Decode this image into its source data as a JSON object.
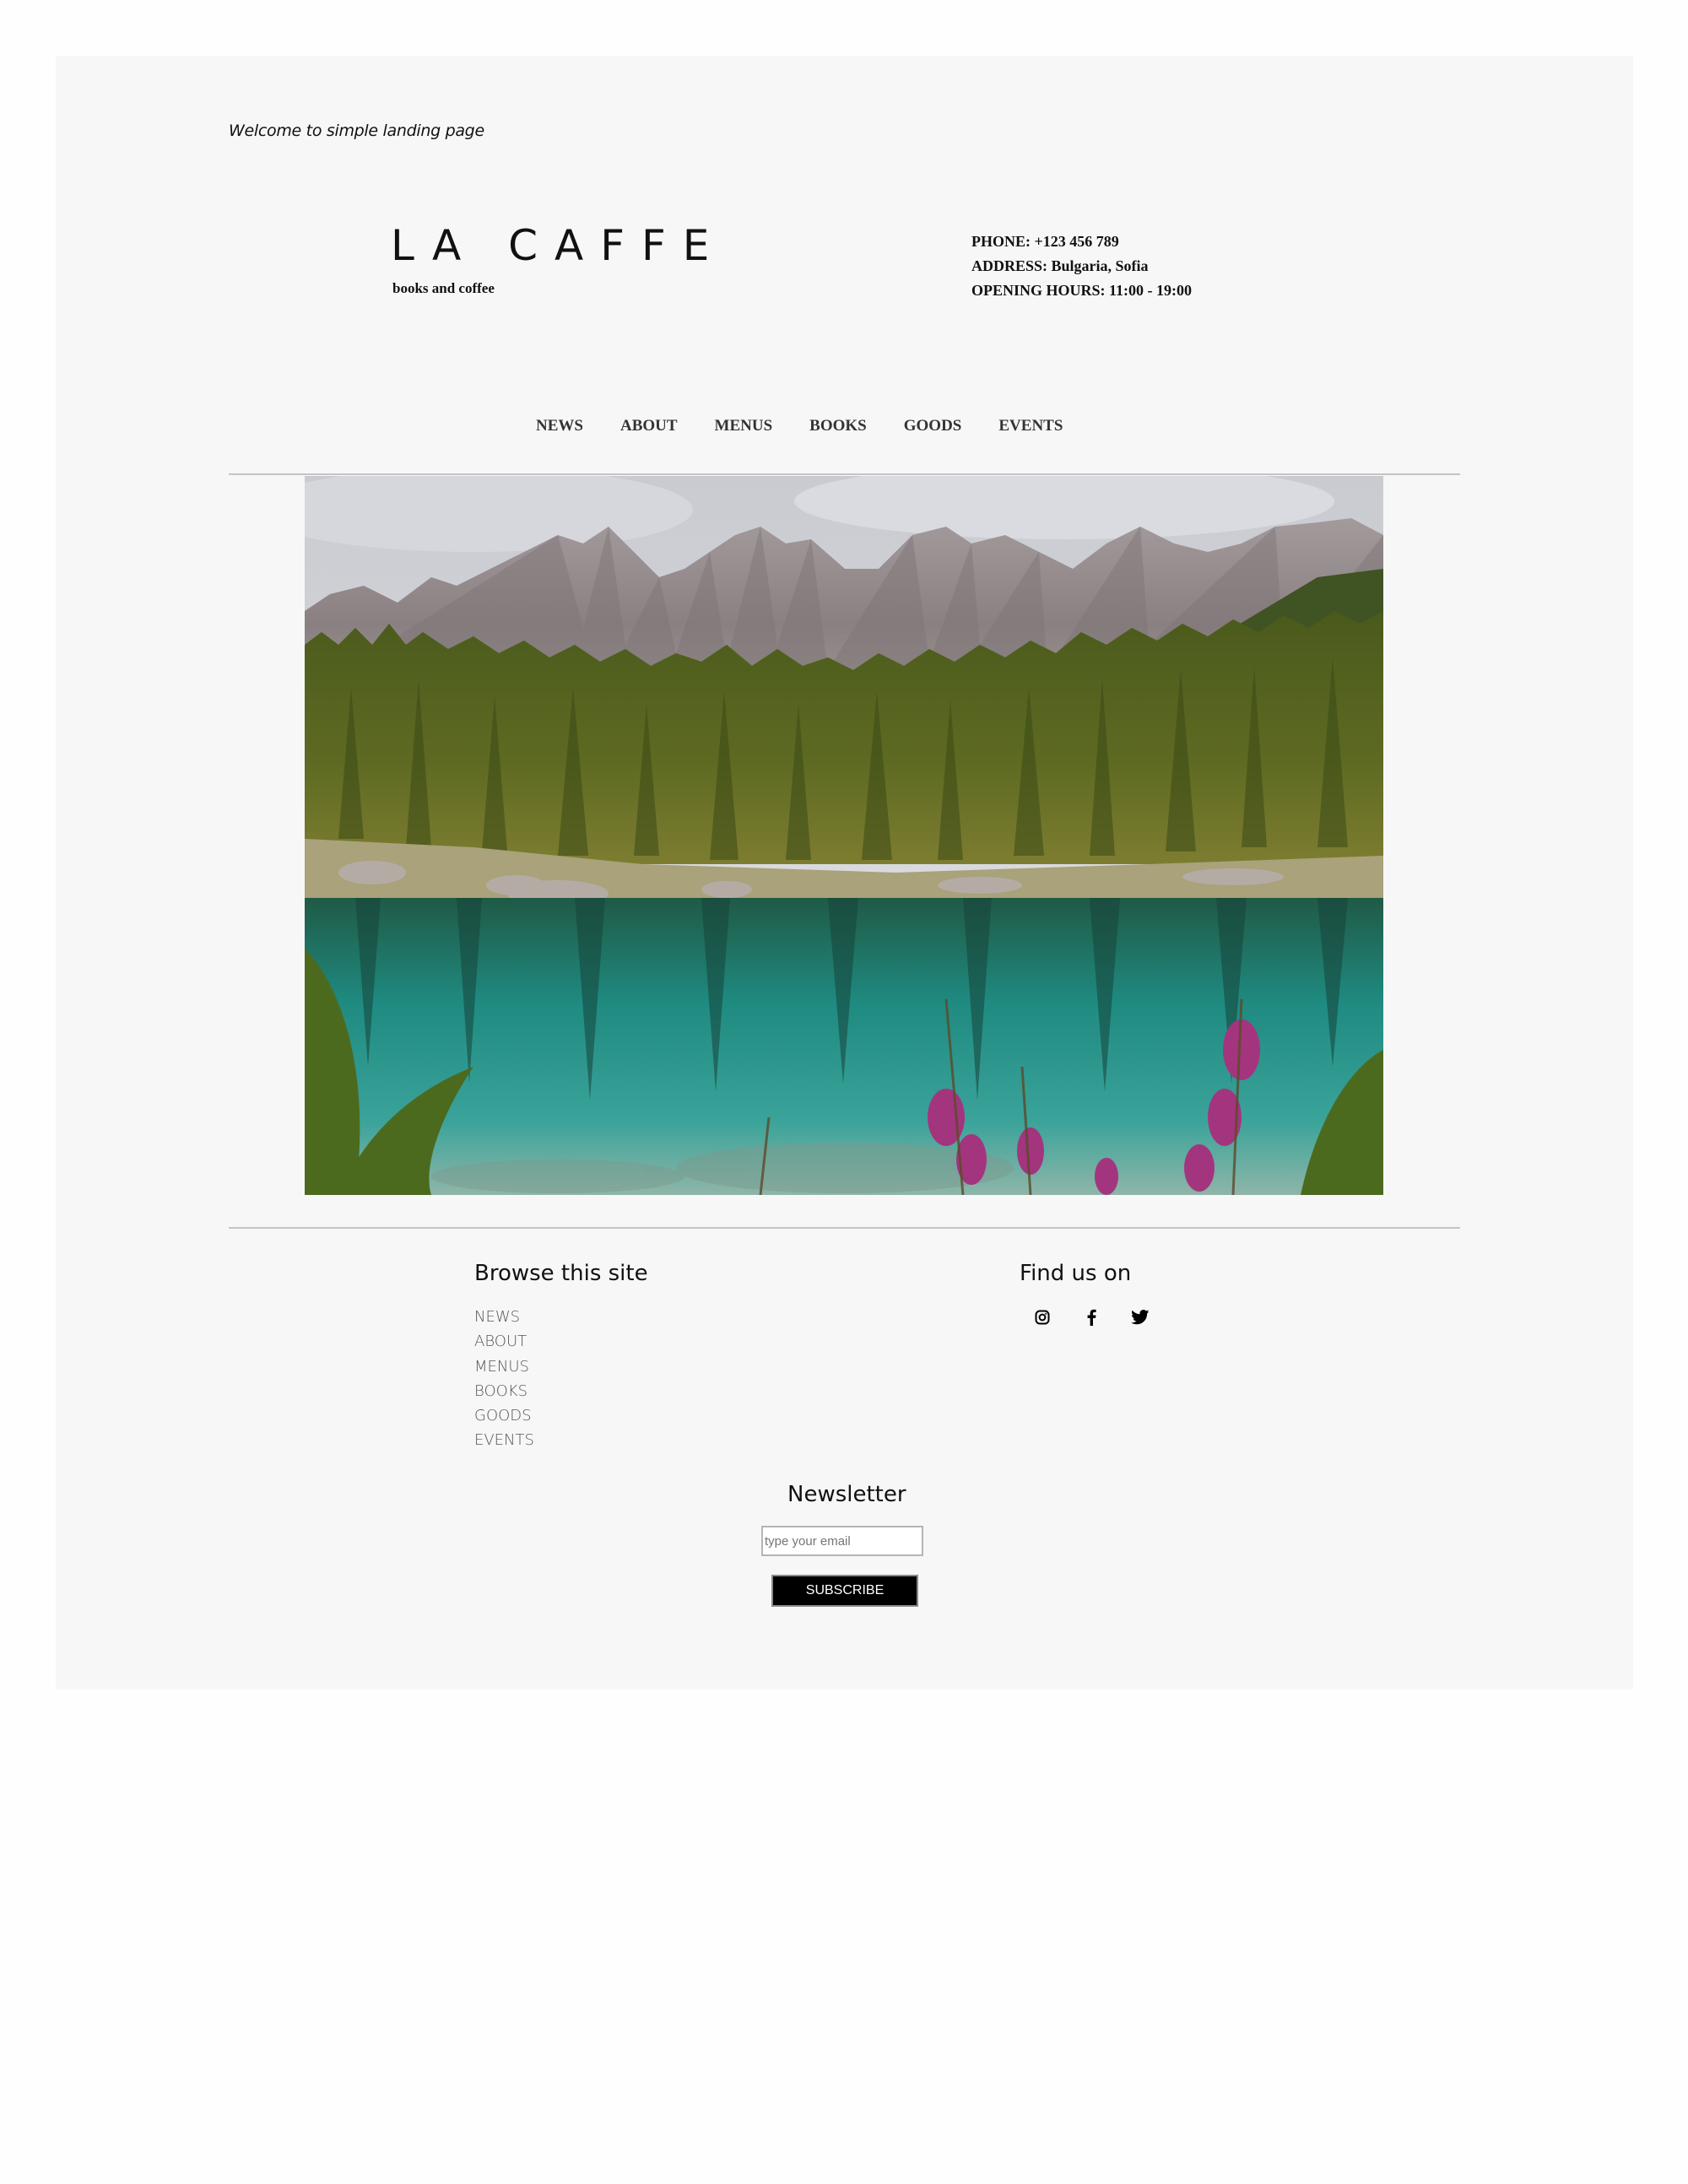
{
  "header": {
    "welcome": "Welcome to simple landing page",
    "logo_title": "LA CAFFE",
    "logo_subtitle": "books and coffee",
    "contact": {
      "phone": "PHONE: +123 456 789",
      "address": "ADDRESS: Bulgaria, Sofia",
      "hours": "OPENING HOURS: 11:00 - 19:00"
    }
  },
  "nav": {
    "items": [
      "NEWS",
      "ABOUT",
      "MENUS",
      "BOOKS",
      "GOODS",
      "EVENTS"
    ]
  },
  "hero": {
    "image": "mountain-lake-landscape"
  },
  "footer": {
    "browse_title": "Browse this site",
    "browse_items": [
      "NEWS",
      "ABOUT",
      "MENUS",
      "BOOKS",
      "GOODS",
      "EVENTS"
    ],
    "find_title": "Find us on",
    "social_icons": [
      "instagram-icon",
      "facebook-icon",
      "twitter-icon"
    ],
    "newsletter_title": "Newsletter",
    "email_placeholder": "type your email",
    "subscribe_label": "SUBSCRIBE"
  },
  "colors": {
    "page_background": "#f7f7f7",
    "outer_background": "#fefefe",
    "text": "#111111",
    "button_background": "#000000",
    "rule": "#c4c4c4"
  }
}
